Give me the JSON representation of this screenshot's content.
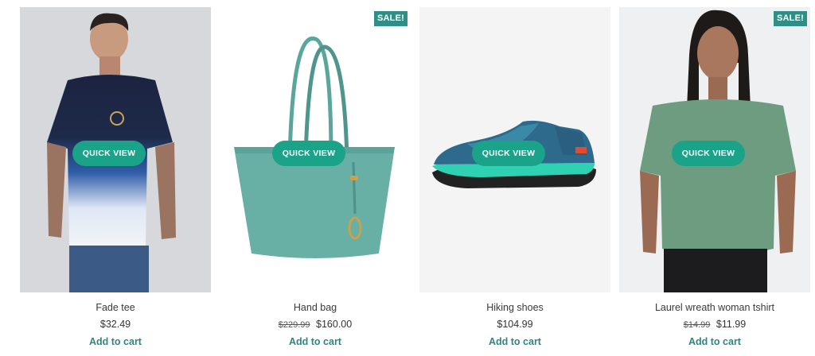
{
  "quick_view_label": "QUICK VIEW",
  "sale_label": "SALE!",
  "add_to_cart_label": "Add to cart",
  "colors": {
    "accent": "#1aa389",
    "badge": "#2f8f86",
    "cart_link": "#2f8580"
  },
  "products": [
    {
      "name": "Fade tee",
      "price": "$32.49",
      "old_price": "",
      "on_sale": false,
      "image_icon": "tshirt-man-icon"
    },
    {
      "name": "Hand bag",
      "price": "$160.00",
      "old_price": "$229.99",
      "on_sale": true,
      "image_icon": "handbag-icon"
    },
    {
      "name": "Hiking shoes",
      "price": "$104.99",
      "old_price": "",
      "on_sale": false,
      "image_icon": "shoe-icon"
    },
    {
      "name": "Laurel wreath woman tshirt",
      "price": "$11.99",
      "old_price": "$14.99",
      "on_sale": true,
      "image_icon": "tshirt-woman-icon"
    }
  ]
}
